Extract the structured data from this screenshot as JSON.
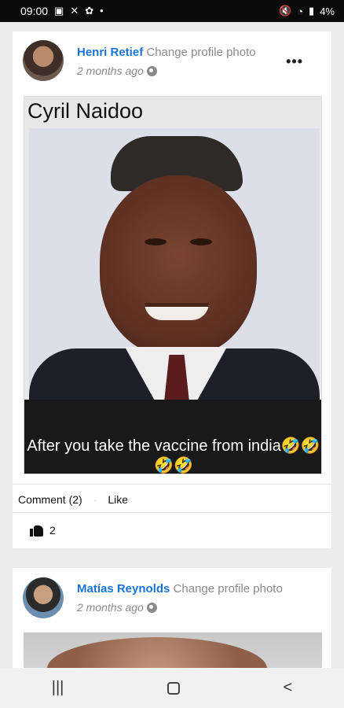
{
  "status": {
    "time": "09:00",
    "battery": "4%",
    "left_icons": [
      "gallery-icon",
      "tools-icon",
      "app-icon",
      "dot"
    ],
    "right_icons": [
      "mute-icon",
      "wifi-icon",
      "signal-icon",
      "battery-icon"
    ]
  },
  "posts": [
    {
      "author": "Henri Retief",
      "action": "Change profile photo",
      "time": "2 months ago",
      "more": "•••",
      "meme_title": "Cyril Naidoo",
      "meme_caption": "After you take the vaccine from india🤣🤣🤣🤣",
      "comment_link": "Comment (2)",
      "separator": "·",
      "like_link": "Like",
      "like_count": "2"
    },
    {
      "author": "Matías Reynolds",
      "action": "Change profile photo",
      "time": "2 months ago"
    }
  ],
  "nav": {
    "recent": "|||",
    "back": "<"
  }
}
